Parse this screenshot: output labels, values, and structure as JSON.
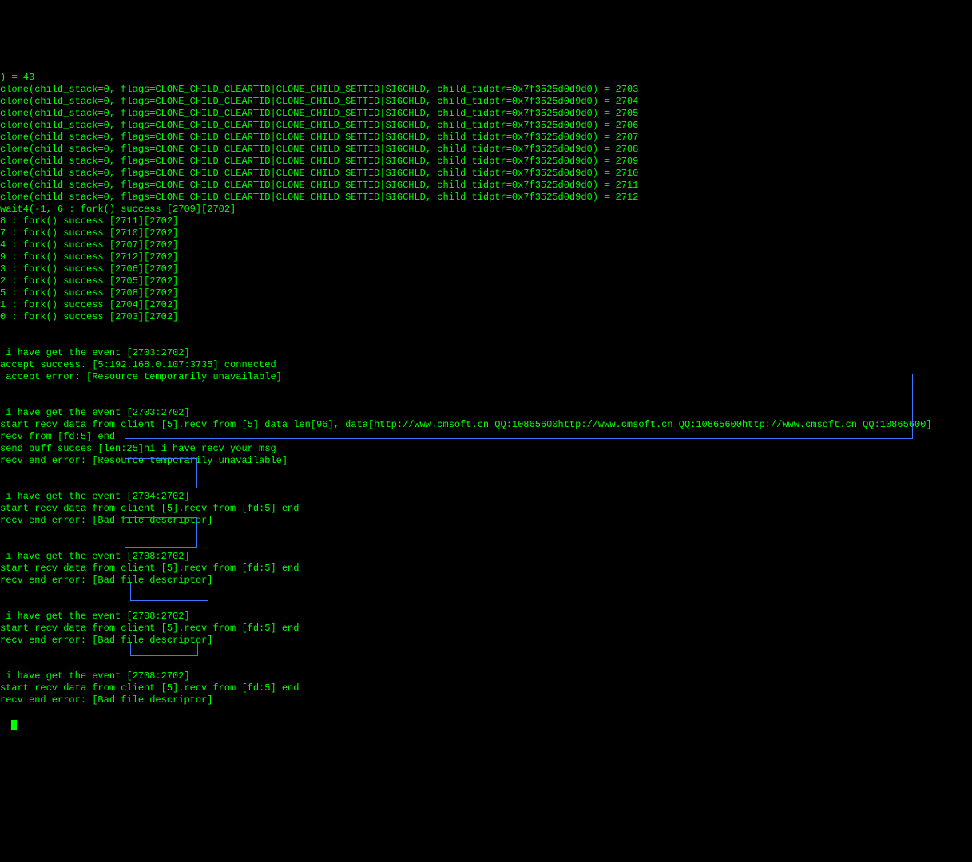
{
  "lines": [
    ") = 43",
    "clone(child_stack=0, flags=CLONE_CHILD_CLEARTID|CLONE_CHILD_SETTID|SIGCHLD, child_tidptr=0x7f3525d0d9d0) = 2703",
    "clone(child_stack=0, flags=CLONE_CHILD_CLEARTID|CLONE_CHILD_SETTID|SIGCHLD, child_tidptr=0x7f3525d0d9d0) = 2704",
    "clone(child_stack=0, flags=CLONE_CHILD_CLEARTID|CLONE_CHILD_SETTID|SIGCHLD, child_tidptr=0x7f3525d0d9d0) = 2705",
    "clone(child_stack=0, flags=CLONE_CHILD_CLEARTID|CLONE_CHILD_SETTID|SIGCHLD, child_tidptr=0x7f3525d0d9d0) = 2706",
    "clone(child_stack=0, flags=CLONE_CHILD_CLEARTID|CLONE_CHILD_SETTID|SIGCHLD, child_tidptr=0x7f3525d0d9d0) = 2707",
    "clone(child_stack=0, flags=CLONE_CHILD_CLEARTID|CLONE_CHILD_SETTID|SIGCHLD, child_tidptr=0x7f3525d0d9d0) = 2708",
    "clone(child_stack=0, flags=CLONE_CHILD_CLEARTID|CLONE_CHILD_SETTID|SIGCHLD, child_tidptr=0x7f3525d0d9d0) = 2709",
    "clone(child_stack=0, flags=CLONE_CHILD_CLEARTID|CLONE_CHILD_SETTID|SIGCHLD, child_tidptr=0x7f3525d0d9d0) = 2710",
    "clone(child_stack=0, flags=CLONE_CHILD_CLEARTID|CLONE_CHILD_SETTID|SIGCHLD, child_tidptr=0x7f3525d0d9d0) = 2711",
    "clone(child_stack=0, flags=CLONE_CHILD_CLEARTID|CLONE_CHILD_SETTID|SIGCHLD, child_tidptr=0x7f3525d0d9d0) = 2712",
    "wait4(-1, 6 : fork() success [2709][2702]",
    "8 : fork() success [2711][2702]",
    "7 : fork() success [2710][2702]",
    "4 : fork() success [2707][2702]",
    "9 : fork() success [2712][2702]",
    "3 : fork() success [2706][2702]",
    "2 : fork() success [2705][2702]",
    "5 : fork() success [2708][2702]",
    "1 : fork() success [2704][2702]",
    "0 : fork() success [2703][2702]",
    "",
    "",
    " i have get the event [2703:2702]",
    "accept success. [5:192.168.0.107:3735] connected",
    " accept error: [Resource temporarily unavailable]",
    "",
    "",
    " i have get the event [2703:2702]",
    "start recv data from client [5].recv from [5] data len[96], data[http://www.cmsoft.cn QQ:10865600http://www.cmsoft.cn QQ:10865600http://www.cmsoft.cn QQ:10865600]",
    "recv from [fd:5] end",
    "send buff succes [len:25]hi i have recv your msg",
    "recv end error: [Resource temporarily unavailable]",
    "",
    "",
    " i have get the event [2704:2702]",
    "start recv data from client [5].recv from [fd:5] end",
    "recv end error: [Bad file descriptor]",
    "",
    "",
    " i have get the event [2708:2702]",
    "start recv data from client [5].recv from [fd:5] end",
    "recv end error: [Bad file descriptor]",
    "",
    "",
    " i have get the event [2708:2702]",
    "start recv data from client [5].recv from [fd:5] end",
    "recv end error: [Bad file descriptor]",
    "",
    "",
    " i have get the event [2708:2702]",
    "start recv data from client [5].recv from [fd:5] end",
    "recv end error: [Bad file descriptor]"
  ]
}
